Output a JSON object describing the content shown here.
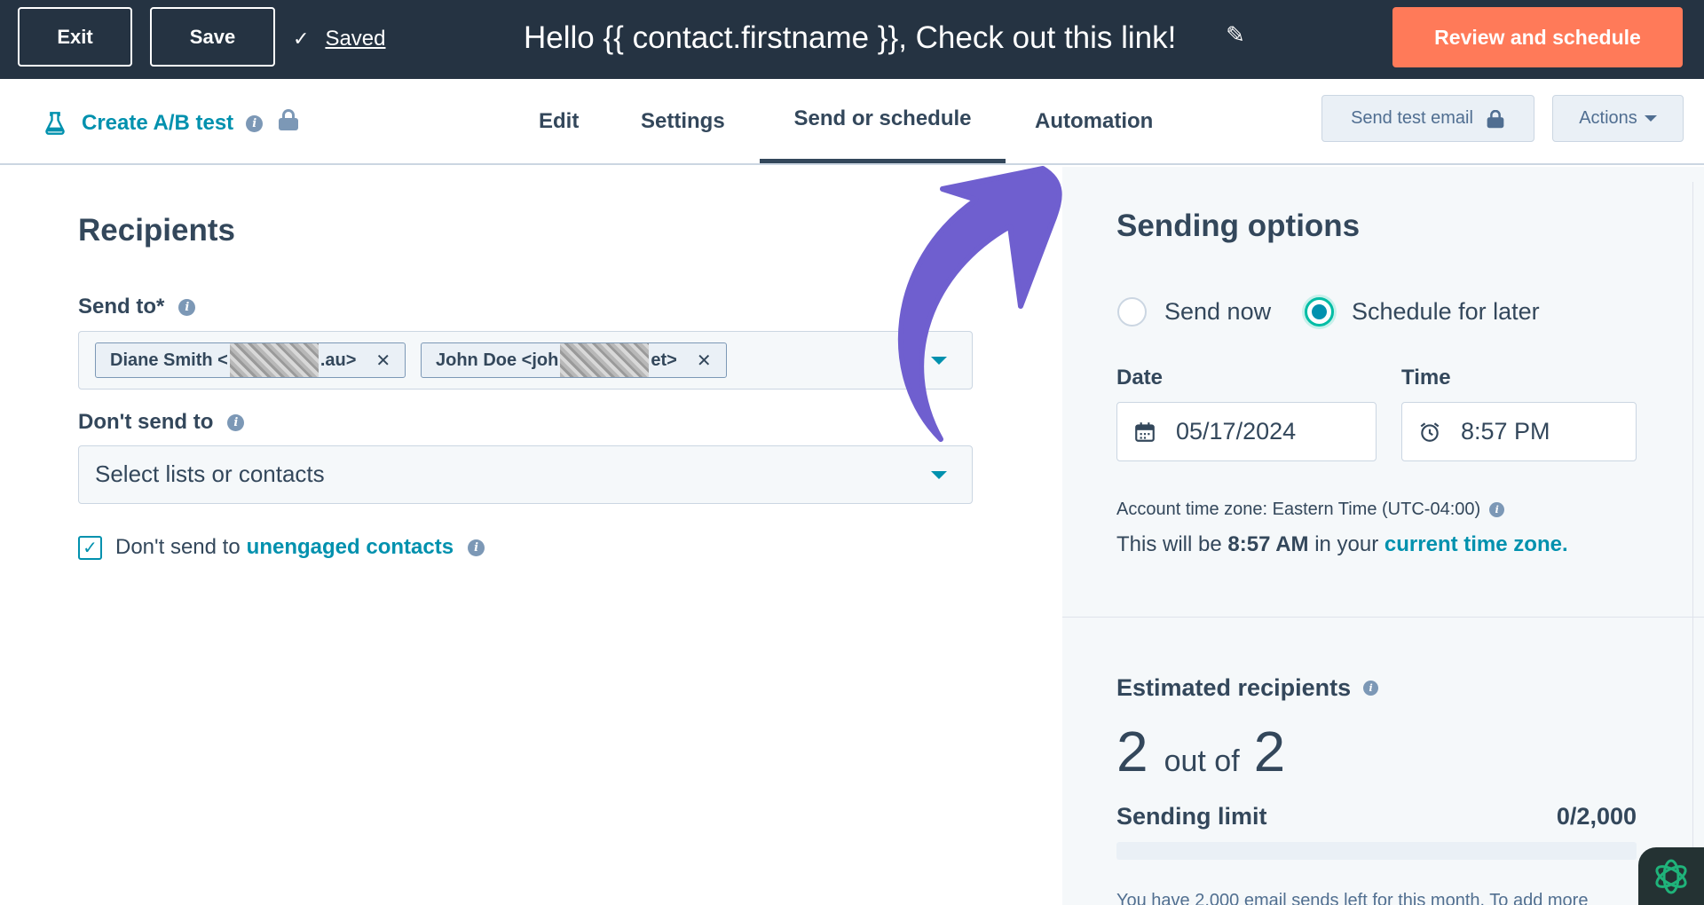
{
  "topbar": {
    "exit_label": "Exit",
    "save_label": "Save",
    "saved_label": "Saved",
    "email_subject": "Hello {{ contact.firstname }}, Check out this link!",
    "review_label": "Review and schedule",
    "icons": {
      "saved": "check-icon",
      "rename": "pencil-icon"
    }
  },
  "nav": {
    "ab_test_label": "Create A/B test",
    "tabs": [
      {
        "label": "Edit",
        "active": false
      },
      {
        "label": "Settings",
        "active": false
      },
      {
        "label": "Send or schedule",
        "active": true
      },
      {
        "label": "Automation",
        "active": false
      }
    ],
    "send_test_label": "Send test email",
    "actions_label": "Actions"
  },
  "recipients": {
    "heading": "Recipients",
    "send_to_label": "Send to*",
    "send_to_tags": [
      {
        "prefix": "Diane Smith <",
        "suffix": ".au>"
      },
      {
        "prefix": "John Doe <joh",
        "suffix": "et>"
      }
    ],
    "dont_send_label": "Don't send to",
    "dont_send_placeholder": "Select lists or contacts",
    "unengaged_prefix": "Don't send to",
    "unengaged_link": "unengaged contacts",
    "unengaged_checked": true
  },
  "sending": {
    "heading": "Sending options",
    "send_now_label": "Send now",
    "schedule_label": "Schedule for later",
    "selected": "schedule",
    "date_label": "Date",
    "date_value": "05/17/2024",
    "time_label": "Time",
    "time_value": "8:57 PM",
    "timezone_text": "Account time zone: Eastern Time (UTC-04:00)",
    "will_be_prefix": "This will be",
    "will_be_time": "8:57 AM",
    "will_be_mid": "in your",
    "will_be_link": "current time zone."
  },
  "estimate": {
    "heading": "Estimated recipients",
    "count": "2",
    "out_of_label": "out of",
    "total": "2",
    "limit_label": "Sending limit",
    "limit_value": "0/2,000",
    "limit_fraction": 0,
    "footnote": "You have 2,000 email sends left for this month. To add more"
  },
  "colors": {
    "topbar_bg": "#253342",
    "accent_orange": "#ff7a59",
    "link_teal": "#0091ae",
    "annotation_arrow": "#6f5fcf"
  }
}
